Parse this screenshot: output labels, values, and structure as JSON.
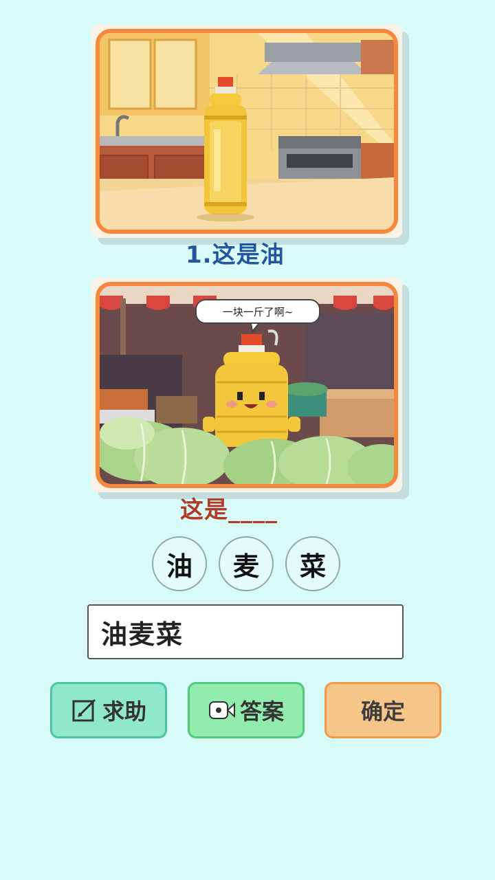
{
  "question1": {
    "caption": "1.这是油"
  },
  "question2": {
    "speech_bubble": "一块一斤了啊~",
    "caption": "这是____"
  },
  "char_options": [
    "油",
    "麦",
    "菜"
  ],
  "answer_input": {
    "value": "油麦菜"
  },
  "buttons": {
    "help_label": "求助",
    "help_icon": "edit-icon",
    "answer_label": "答案",
    "answer_icon": "video-icon",
    "confirm_label": "确定"
  },
  "colors": {
    "background": "#d8fbf8",
    "frame_orange": "#f5883b",
    "caption_blue": "#24559e",
    "caption_red": "#b03a25"
  }
}
